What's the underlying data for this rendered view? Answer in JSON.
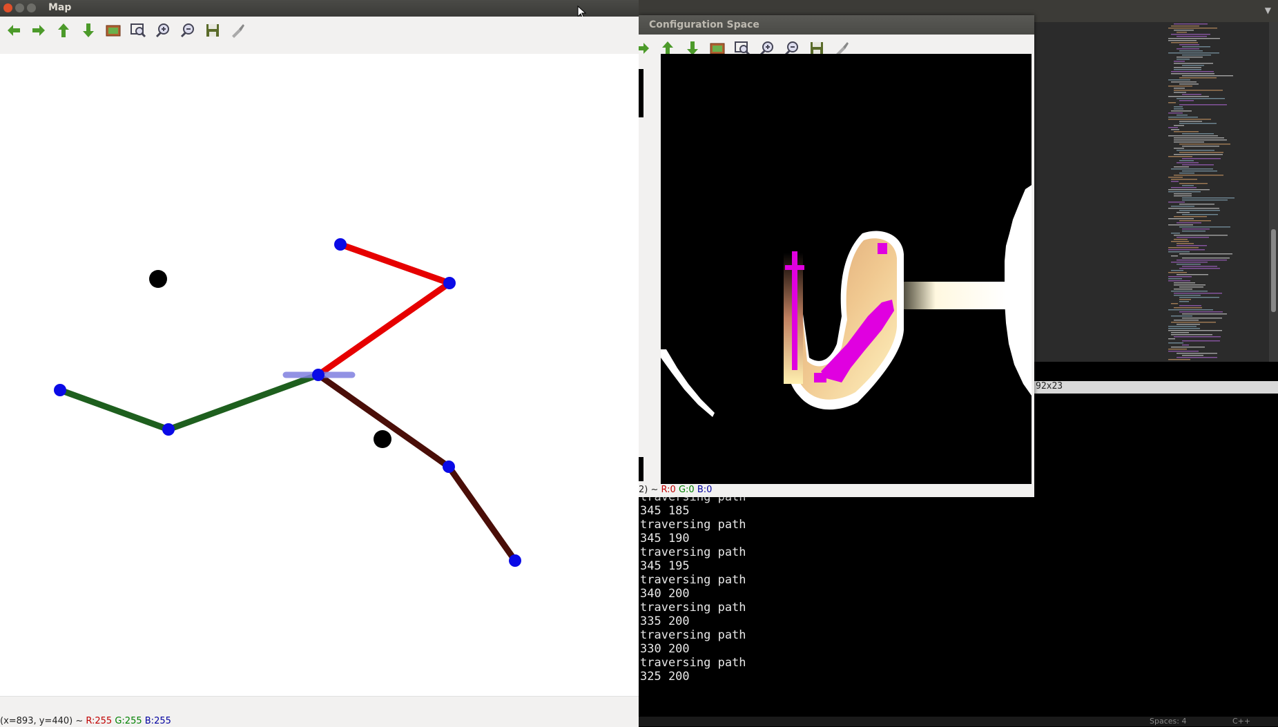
{
  "map_window": {
    "title": "Map",
    "toolbar": [
      {
        "icon": "arrow-left-icon",
        "color": "#3a8f1f"
      },
      {
        "icon": "arrow-right-icon",
        "color": "#3a8f1f"
      },
      {
        "icon": "arrow-up-icon",
        "color": "#3a8f1f"
      },
      {
        "icon": "arrow-down-icon",
        "color": "#3a8f1f"
      },
      {
        "icon": "image-icon",
        "color": "#a0522d"
      },
      {
        "icon": "zoom-fit-icon",
        "color": "#557"
      },
      {
        "icon": "zoom-in-icon",
        "color": "#557"
      },
      {
        "icon": "zoom-out-icon",
        "color": "#557"
      },
      {
        "icon": "save-icon",
        "color": "#556b2f"
      },
      {
        "icon": "properties-icon",
        "color": "#888"
      }
    ],
    "status": {
      "coords": "(x=893, y=440) ~ ",
      "r": "R:255",
      "g": "G:255",
      "b": "B:255"
    },
    "colors": {
      "joint": "#0a0ae6",
      "obstacle": "#000000",
      "red_arm": "#e60000",
      "green_arm": "#1e5f1e",
      "brown_arm": "#4a0e08",
      "gripper": "#8080e0"
    }
  },
  "config_window": {
    "title": "Configuration Space",
    "status": {
      "prefix": "2) ~ ",
      "r": "R:0",
      "g": "G:0",
      "b": "B:0"
    },
    "colors": {
      "background": "#000000",
      "obstacle": "#ffffff",
      "path": "#e000e0",
      "region_light": "#fff3c0",
      "region_dark": "#d9a070"
    }
  },
  "terminal": {
    "size_label": "92x23",
    "lines": [
      "traversing path",
      "345 185",
      "traversing path",
      "345 190",
      "traversing path",
      "345 195",
      "traversing path",
      "340 200",
      "traversing path",
      "335 200",
      "traversing path",
      "330 200",
      "traversing path",
      "325 200"
    ]
  },
  "editor_status": {
    "spaces": "Spaces: 4",
    "language": "C++"
  }
}
